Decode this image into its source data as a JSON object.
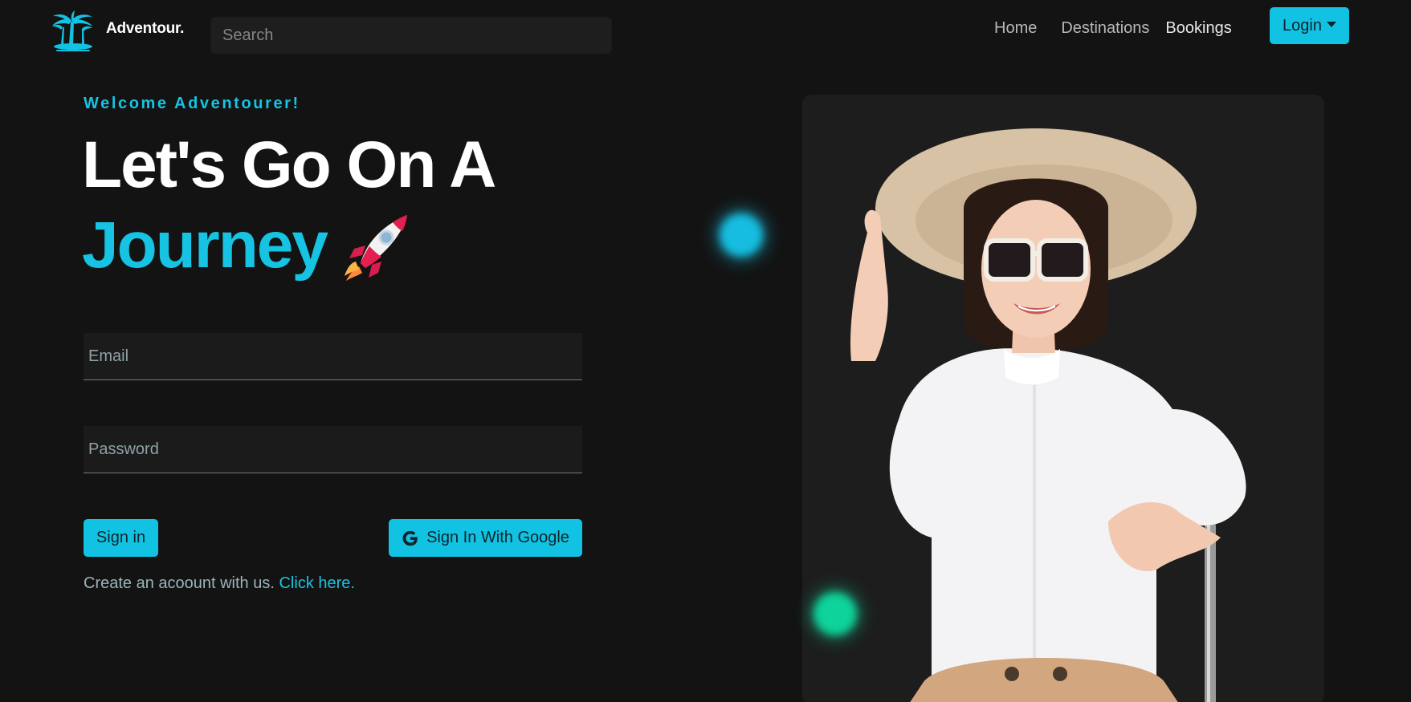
{
  "brand": {
    "name": "Adventour.",
    "logo_icon": "palm-tree-icon"
  },
  "search": {
    "placeholder": "Search"
  },
  "nav": {
    "links": [
      "Home",
      "Destinations",
      "Bookings"
    ],
    "login_label": "Login"
  },
  "hero": {
    "welcome": "Welcome Adventourer!",
    "headline_1": "Let's Go On A",
    "headline_2": "Journey",
    "rocket_icon": "rocket-icon"
  },
  "form": {
    "email_placeholder": "Email",
    "password_placeholder": "Password",
    "signin_label": "Sign in",
    "google_label": "Sign In With Google",
    "create_text": "Create an acoount with us.",
    "create_link": "Click here."
  },
  "colors": {
    "accent": "#12c2e3",
    "background": "#131313",
    "card": "#1d1d1d",
    "glow_green": "#0ed39a"
  }
}
